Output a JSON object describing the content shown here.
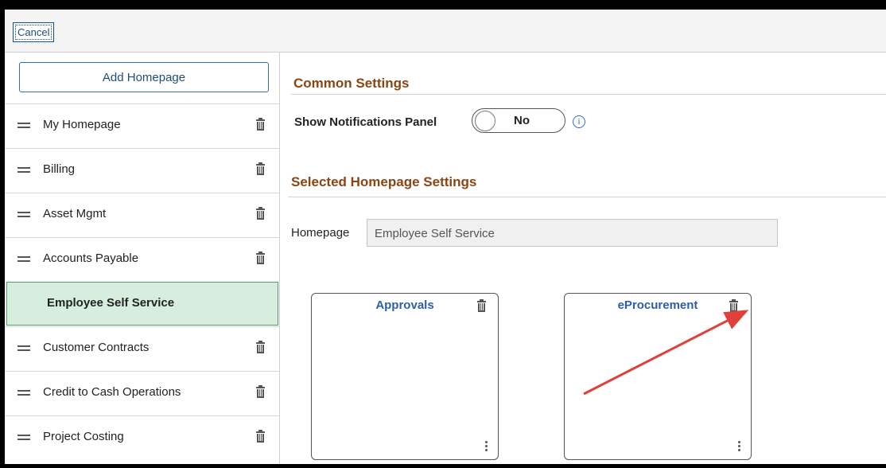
{
  "toolbar": {
    "cancel_label": "Cancel"
  },
  "sidebar": {
    "add_homepage_label": "Add Homepage",
    "items": [
      {
        "label": "My Homepage"
      },
      {
        "label": "Billing"
      },
      {
        "label": "Asset Mgmt"
      },
      {
        "label": "Accounts Payable"
      },
      {
        "label": "Employee Self Service",
        "selected": true
      },
      {
        "label": "Customer Contracts"
      },
      {
        "label": "Credit to Cash Operations"
      },
      {
        "label": "Project Costing"
      }
    ]
  },
  "common_settings": {
    "title": "Common Settings",
    "notifications_label": "Show Notifications Panel",
    "notifications_value": "No"
  },
  "selected_homepage_settings": {
    "title": "Selected Homepage Settings",
    "homepage_label": "Homepage",
    "homepage_value": "Employee Self Service"
  },
  "tiles": [
    {
      "title": "Approvals"
    },
    {
      "title": "eProcurement"
    }
  ],
  "icons": {
    "drag_handle": "drag-handle-icon",
    "trash": "trash-icon",
    "info": "info-icon",
    "menu": "kebab-menu-icon"
  },
  "colors": {
    "section_title": "#8b4513",
    "link_blue": "#1f4e79",
    "selected_bg": "#d7eede",
    "annotation_arrow": "#e0403a"
  }
}
